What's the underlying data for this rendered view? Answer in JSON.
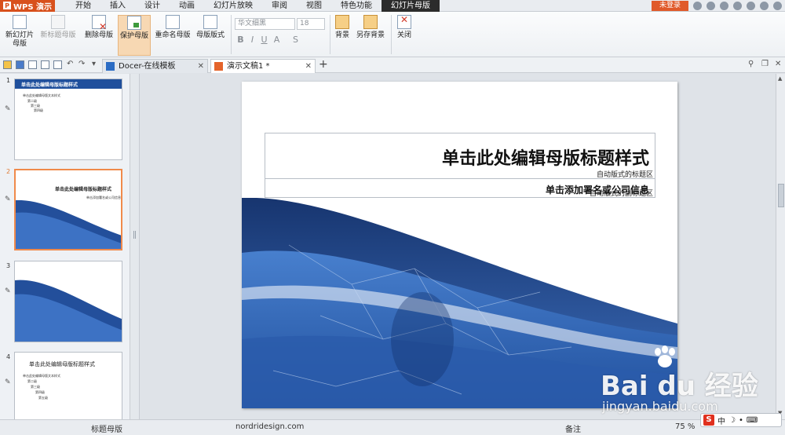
{
  "app": {
    "name": "WPS 演示",
    "login": "未登录"
  },
  "menu": [
    "开始",
    "插入",
    "设计",
    "动画",
    "幻灯片放映",
    "审阅",
    "视图",
    "特色功能",
    "幻灯片母版"
  ],
  "ribbon": {
    "new_master": "新幻灯片母版",
    "new_master_1": "新幻灯片",
    "new_master_2": "母版",
    "new_title_master": "新标题母版",
    "delete_master": "删除母版",
    "protect_master": "保护母版",
    "rename_master": "重命名母版",
    "master_layout": "母版版式",
    "font_name": "华文细黑",
    "font_size": "18",
    "bold": "B",
    "italic": "I",
    "underline": "U",
    "shadow": "A",
    "spacing": "S",
    "background": "背景",
    "save_background": "另存背景",
    "close": "关闭"
  },
  "tabs": {
    "docer": "Docer-在线模板",
    "document": "演示文稿1 *"
  },
  "thumbnails": [
    {
      "num": "1",
      "title": "单击此处编辑母版标题样式",
      "lines": [
        "单击此处编辑母版文本样式",
        "第二级",
        "第三级",
        "第四级"
      ]
    },
    {
      "num": "2",
      "title": "单击此处编辑母版标题样式",
      "subtitle": "单击添加署名或公司信息"
    },
    {
      "num": "3"
    },
    {
      "num": "4",
      "title": "单击此处编辑母版标题样式",
      "lines": [
        "单击此处编辑母版文本样式",
        "第二级",
        "第三级",
        "第四级",
        "第五级"
      ]
    }
  ],
  "slide": {
    "title": "单击此处编辑母版标题样式",
    "title_note": "自动版式的标题区",
    "subtitle": "单击添加署名或公司信息",
    "subtitle_note": "自动版式的副标题区"
  },
  "status": {
    "layout_name": "标题母版",
    "design": "nordridesign.com",
    "notes": "备注",
    "zoom": "75 %"
  },
  "watermark": {
    "brand": "Bai du 经验",
    "url": "jingyan.baidu.com"
  },
  "ime": {
    "label": "中"
  },
  "colors": {
    "accent": "#d8501c",
    "selected_border": "#f08a4b",
    "slide_blue": "#1f4f9c"
  }
}
